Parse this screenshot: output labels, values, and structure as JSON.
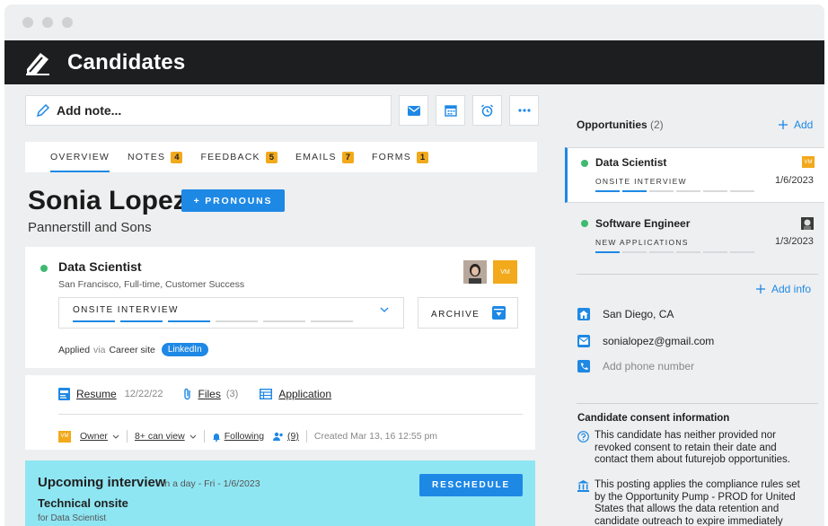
{
  "app": {
    "title": "Candidates"
  },
  "toolbar": {
    "add_note": "Add note..."
  },
  "tabs": [
    {
      "label": "OVERVIEW",
      "badge": ""
    },
    {
      "label": "NOTES",
      "badge": "4"
    },
    {
      "label": "FEEDBACK",
      "badge": "5"
    },
    {
      "label": "EMAILS",
      "badge": "7"
    },
    {
      "label": "FORMS",
      "badge": "1"
    }
  ],
  "candidate": {
    "name": "Sonia Lopez",
    "pronouns_button": "+ PRONOUNS",
    "company": "Pannerstill and Sons"
  },
  "application": {
    "title": "Data Scientist",
    "subtitle": "San Francisco, Full-time, Customer Success",
    "avatar_initials": "VM",
    "stage": "ONSITE INTERVIEW",
    "stage_progress": 3,
    "stage_total": 6,
    "archive_label": "ARCHIVE",
    "applied": "Applied",
    "via": "via",
    "source": "Career site",
    "source_tag": "LinkedIn"
  },
  "docs": {
    "resume": "Resume",
    "resume_date": "12/22/22",
    "files": "Files",
    "files_count": "(3)",
    "application": "Application",
    "owner_initials": "VM",
    "owner": "Owner",
    "can_view": "8+ can view",
    "following": "Following",
    "followers": "(9)",
    "created": "Created Mar 13, 16 12:55 pm"
  },
  "upcoming": {
    "title": "Upcoming interview",
    "when": "in a day - Fri - 1/6/2023",
    "reschedule": "RESCHEDULE",
    "type": "Technical onsite",
    "for": "for Data Scientist"
  },
  "opportunities": {
    "heading": "Opportunities",
    "count": "(2)",
    "add": "Add",
    "items": [
      {
        "title": "Data Scientist",
        "stage": "ONSITE INTERVIEW",
        "date": "1/6/2023",
        "progress": 2,
        "total": 6,
        "owner_initials": "VM"
      },
      {
        "title": "Software Engineer",
        "stage": "NEW APPLICATIONS",
        "date": "1/3/2023",
        "progress": 1,
        "total": 6
      }
    ]
  },
  "contact": {
    "add_info": "Add info",
    "location": "San Diego, CA",
    "email": "sonialopez@gmail.com",
    "phone_placeholder": "Add phone number"
  },
  "consent": {
    "heading": "Candidate consent information",
    "text1": "This candidate has neither provided nor revoked consent to retain their date and contact them about futurejob opportunities.",
    "text2": "This posting applies the compliance rules set by the Opportunity Pump - PROD for United States that allows the data retention and candidate outreach to expire immediately when"
  },
  "colors": {
    "accent": "#1e88e5",
    "badge": "#f2a91b",
    "status_green": "#3dba6f",
    "interview_bg": "#8fe6f3",
    "appbar": "#1d1e1f"
  }
}
